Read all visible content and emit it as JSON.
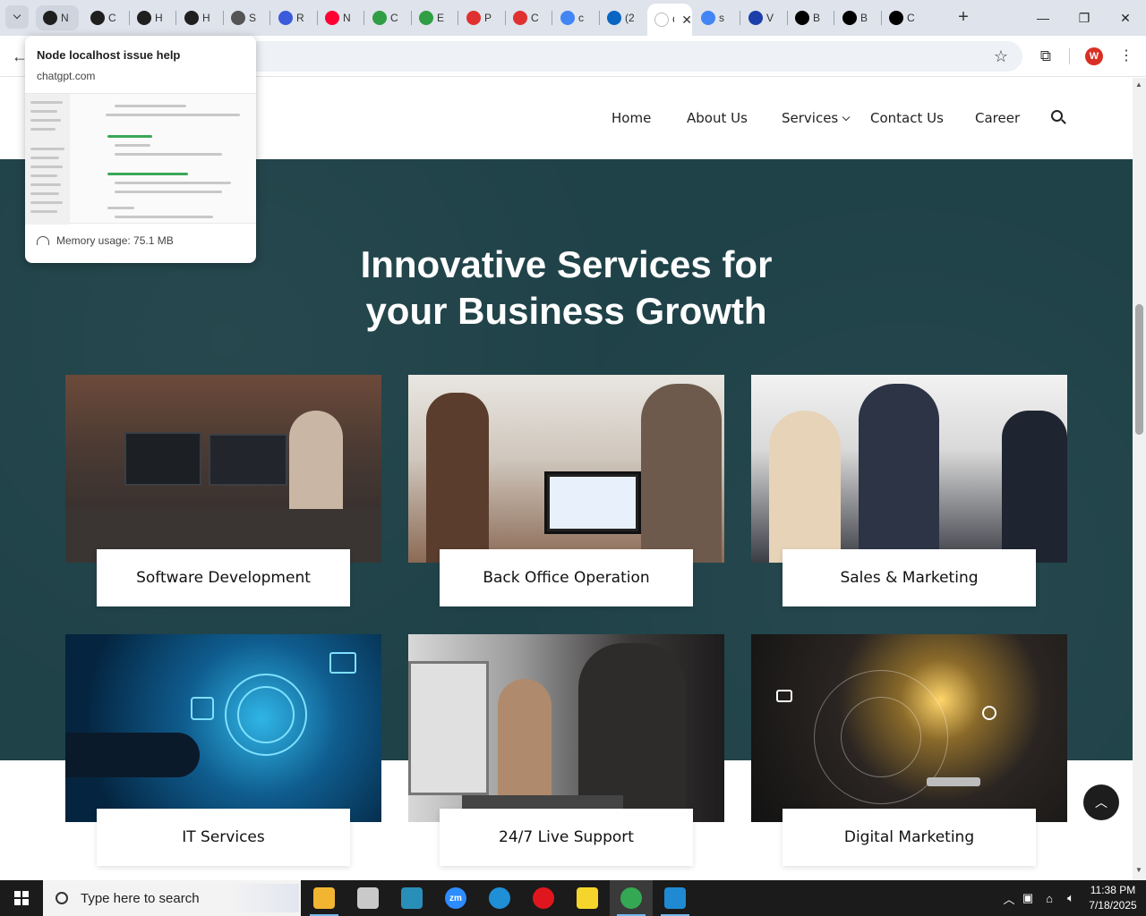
{
  "browser": {
    "tab_search_icon": "chevron-down-icon",
    "tabs": [
      {
        "label": "N",
        "icon": "chatgpt-icon",
        "color": "#1f1f1f",
        "state": "hovered"
      },
      {
        "label": "C",
        "icon": "chatgpt-icon",
        "color": "#1f1f1f"
      },
      {
        "label": "H",
        "icon": "chatgpt-icon",
        "color": "#1f1f1f"
      },
      {
        "label": "H",
        "icon": "chatgpt-icon",
        "color": "#1f1f1f"
      },
      {
        "label": "S",
        "icon": "wordpress-icon",
        "color": "#555555"
      },
      {
        "label": "R",
        "icon": "reddit-like-icon",
        "color": "#3b5bdb"
      },
      {
        "label": "N",
        "icon": "youtube-icon",
        "color": "#ff0033"
      },
      {
        "label": "C",
        "icon": "wix-icon",
        "color": "#2f9e44"
      },
      {
        "label": "E",
        "icon": "extension-icon",
        "color": "#2f9e44"
      },
      {
        "label": "P",
        "icon": "tag-icon",
        "color": "#e03131"
      },
      {
        "label": "C",
        "icon": "tag-icon",
        "color": "#e03131"
      },
      {
        "label": "c",
        "icon": "google-icon",
        "color": "#4285f4"
      },
      {
        "label": "(2",
        "icon": "linkedin-icon",
        "color": "#0a66c2"
      },
      {
        "label": "C",
        "icon": "page-icon",
        "color": "#ffffff",
        "state": "active"
      },
      {
        "label": "s",
        "icon": "google-icon",
        "color": "#4285f4"
      },
      {
        "label": "V",
        "icon": "x-blue-icon",
        "color": "#1c3faa"
      },
      {
        "label": "B",
        "icon": "x-icon",
        "color": "#000000"
      },
      {
        "label": "B",
        "icon": "x-icon",
        "color": "#000000"
      },
      {
        "label": "C",
        "icon": "spark-icon",
        "color": "#000000"
      }
    ],
    "new_tab_icon": "plus-icon",
    "window_controls": [
      "minimize-icon",
      "restore-icon",
      "close-icon"
    ],
    "profile_initial": "W",
    "hover_card": {
      "title": "Node localhost issue help",
      "domain": "chatgpt.com",
      "memory": "Memory usage: 75.1 MB"
    }
  },
  "site": {
    "nav": [
      {
        "label": "Home"
      },
      {
        "label": "About Us"
      },
      {
        "label": "Services",
        "has_dropdown": true
      },
      {
        "label": "Contact Us"
      },
      {
        "label": "Career"
      }
    ],
    "section_title": "Innovative Services for your Business Growth",
    "cards": [
      {
        "label": "Software Development",
        "image": "developers-at-computers-photo"
      },
      {
        "label": "Back Office Operation",
        "image": "team-meeting-laptop-photo"
      },
      {
        "label": "Sales & Marketing",
        "image": "business-team-discussion-photo"
      },
      {
        "label": "IT Services",
        "image": "digital-interface-touch-photo"
      },
      {
        "label": "24/7 Live Support",
        "image": "call-center-agents-photo"
      },
      {
        "label": "Digital Marketing",
        "image": "businessman-digital-icons-photo"
      }
    ],
    "colors": {
      "section_bg": "#1f4248",
      "card_bg": "#ffffff"
    }
  },
  "taskbar": {
    "search_placeholder": "Type here to search",
    "apps": [
      {
        "name": "file-explorer-icon",
        "color": "#f2b531"
      },
      {
        "name": "paint-icon",
        "color": "#c9c9c9"
      },
      {
        "name": "gem-app-icon",
        "color": "#2a8fb8"
      },
      {
        "name": "zoom-icon",
        "color": "#2d8cff",
        "text": "zm"
      },
      {
        "name": "edge-icon",
        "color": "#1f8fd6"
      },
      {
        "name": "opera-icon",
        "color": "#e0161e"
      },
      {
        "name": "sticky-notes-icon",
        "color": "#f5d52b"
      },
      {
        "name": "chrome-icon",
        "color": "#34a853"
      },
      {
        "name": "vscode-icon",
        "color": "#1f8ad2"
      }
    ],
    "time": "11:38 PM",
    "date": "7/18/2025"
  }
}
